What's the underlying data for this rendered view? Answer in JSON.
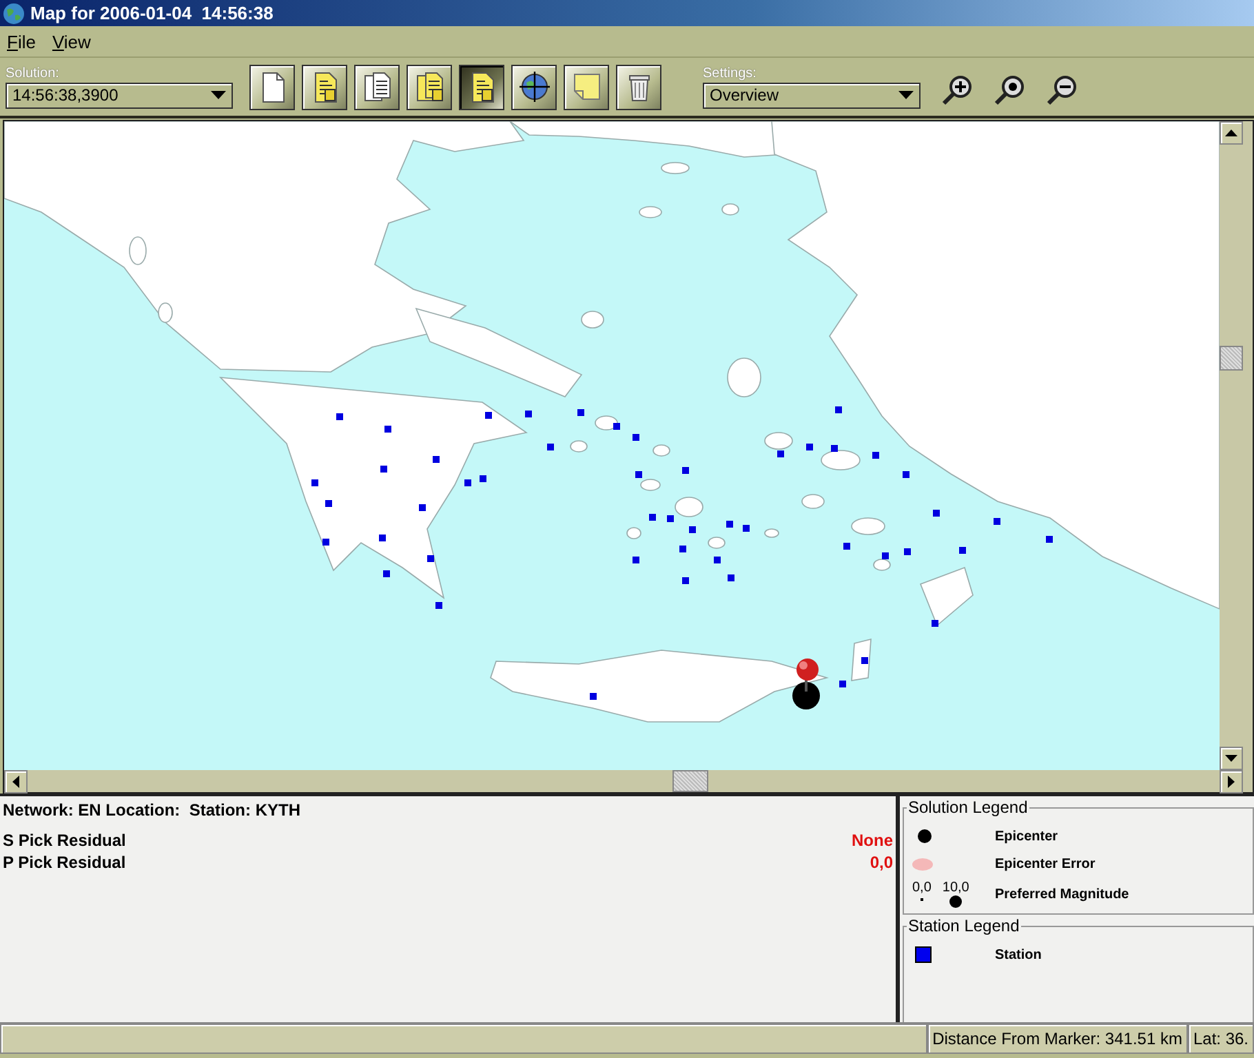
{
  "window": {
    "title": "Map for 2006-01-04  14:56:38"
  },
  "menu": [
    {
      "label": "File"
    },
    {
      "label": "View"
    }
  ],
  "solution": {
    "label": "Solution:",
    "value": "14:56:38,3900"
  },
  "tools": [
    {
      "kind": "page",
      "pressed": false
    },
    {
      "kind": "report",
      "pressed": false
    },
    {
      "kind": "pages",
      "pressed": false
    },
    {
      "kind": "reports",
      "pressed": false
    },
    {
      "kind": "report",
      "pressed": true
    },
    {
      "kind": "target",
      "pressed": false
    },
    {
      "kind": "note",
      "pressed": false
    },
    {
      "kind": "trash",
      "pressed": false
    }
  ],
  "settings": {
    "label": "Settings:",
    "value": "Overview"
  },
  "zoom_tools": [
    {
      "kind": "zoom-in"
    },
    {
      "kind": "zoom-reset"
    },
    {
      "kind": "zoom-out"
    }
  ],
  "info": {
    "header": "Network: EN Location:  Station: KYTH",
    "rows": [
      {
        "label": "S Pick Residual",
        "value": "None"
      },
      {
        "label": "P Pick Residual",
        "value": "0,0"
      }
    ]
  },
  "solution_legend": {
    "title": "Solution Legend",
    "items": [
      {
        "kind": "epicenter",
        "label": "Epicenter"
      },
      {
        "kind": "error",
        "label": "Epicenter Error"
      },
      {
        "kind": "magnitude",
        "label": "Preferred Magnitude",
        "min": "0,0",
        "max": "10,0"
      }
    ]
  },
  "station_legend": {
    "title": "Station Legend",
    "items": [
      {
        "kind": "station",
        "label": "Station"
      }
    ]
  },
  "status_bar": [
    "Distance From Marker: 341.51 km",
    "Lat: 36."
  ]
}
